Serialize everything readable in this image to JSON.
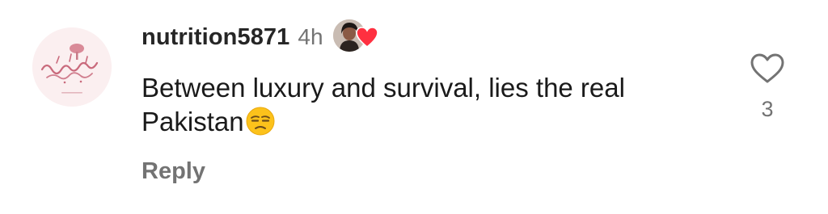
{
  "comment": {
    "username": "nutrition5871",
    "timestamp": "4h",
    "text": "Between luxury and survival, lies the real Pakistan",
    "emoji": "unamused-face-emoji",
    "reply_label": "Reply"
  },
  "likes": {
    "count": "3",
    "icon": "heart-outline-icon"
  },
  "liker": {
    "icon": "heart-filled-icon",
    "heart_color": "#ff3040"
  }
}
